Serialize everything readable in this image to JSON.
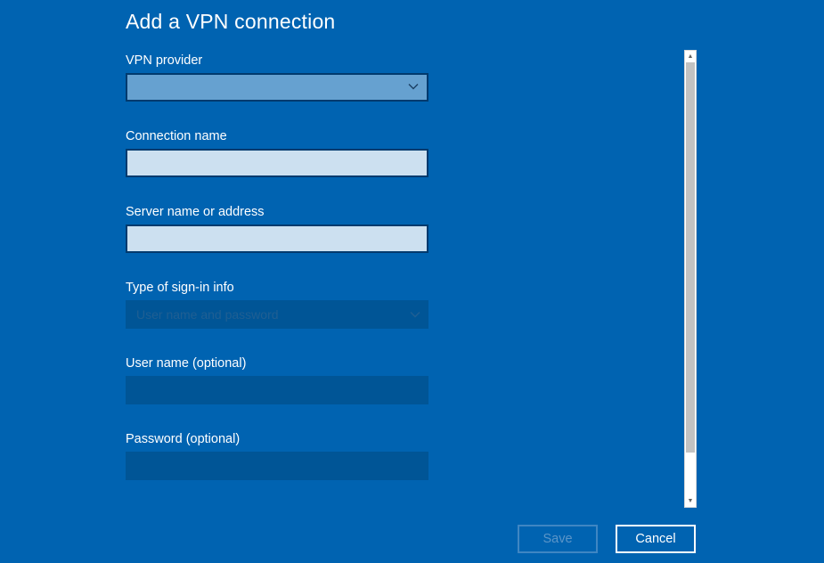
{
  "dialog": {
    "title": "Add a VPN connection"
  },
  "fields": {
    "vpn_provider": {
      "label": "VPN provider",
      "value": ""
    },
    "connection_name": {
      "label": "Connection name",
      "value": ""
    },
    "server_name": {
      "label": "Server name or address",
      "value": ""
    },
    "signin_type": {
      "label": "Type of sign-in info",
      "value": "User name and password",
      "disabled": true
    },
    "user_name": {
      "label": "User name (optional)",
      "value": "",
      "disabled": true
    },
    "password": {
      "label": "Password (optional)",
      "value": "",
      "disabled": true
    }
  },
  "buttons": {
    "save_label": "Save",
    "save_disabled": true,
    "cancel_label": "Cancel"
  },
  "icons": {
    "dropdown": "chevron-down-icon",
    "scroll_up": "scroll-up-arrow-icon",
    "scroll_down": "scroll-down-arrow-icon"
  },
  "colors": {
    "background": "#0063b1",
    "input_active": "#cce0f0",
    "input_disabled": "#005596",
    "provider_select": "#66a1d0"
  }
}
